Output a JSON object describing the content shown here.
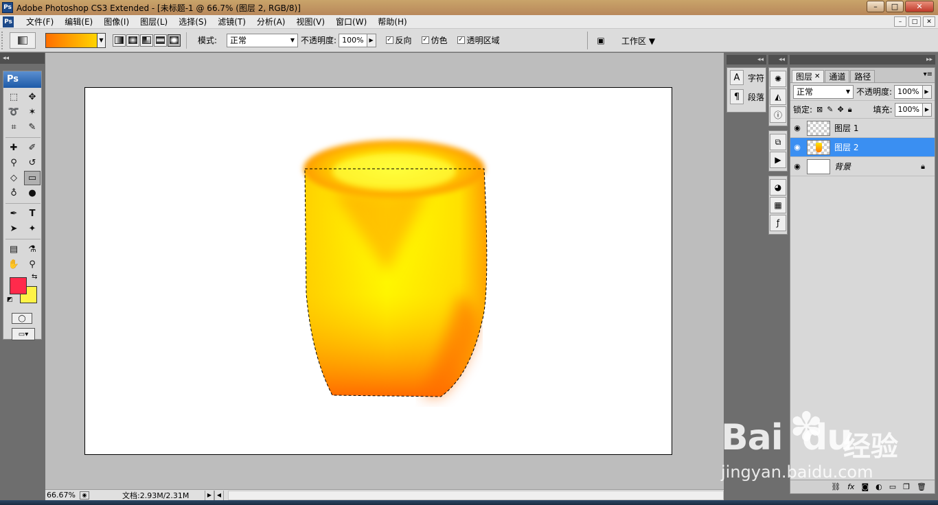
{
  "window": {
    "title": "Adobe Photoshop CS3 Extended - [未标题-1 @ 66.7% (图层 2, RGB/8)]",
    "logo": "Ps",
    "min_label": "–",
    "max_label": "□",
    "close_label": "✕"
  },
  "menu": {
    "items": [
      "文件(F)",
      "编辑(E)",
      "图像(I)",
      "图层(L)",
      "选择(S)",
      "滤镜(T)",
      "分析(A)",
      "视图(V)",
      "窗口(W)",
      "帮助(H)"
    ]
  },
  "options": {
    "mode_label": "模式:",
    "mode_value": "正常",
    "opacity_label": "不透明度:",
    "opacity_value": "100%",
    "reverse_label": "反向",
    "dither_label": "仿色",
    "transparency_label": "透明区域",
    "workspace_label": "工作区 ▼",
    "gradient_colors": [
      "#ff6f00",
      "#ffd400"
    ]
  },
  "tools": {
    "logo": "Ps",
    "foreground_color": "#ff2a4b",
    "background_color": "#fff346"
  },
  "panels": {
    "character_label": "字符",
    "paragraph_label": "段落"
  },
  "layers": {
    "tabs": [
      "图层",
      "通道",
      "路径"
    ],
    "blend_mode": "正常",
    "opacity_label": "不透明度:",
    "opacity_value": "100%",
    "lock_label": "锁定:",
    "fill_label": "填充:",
    "fill_value": "100%",
    "items": [
      {
        "name": "图层 1",
        "selected": false
      },
      {
        "name": "图层 2",
        "selected": true
      },
      {
        "name": "背景",
        "selected": false,
        "locked": true
      }
    ],
    "bottom_icons": [
      "link-icon",
      "fx-icon",
      "mask-icon",
      "adjustment-icon",
      "folder-icon",
      "new-layer-icon",
      "trash-icon"
    ]
  },
  "status": {
    "zoom": "66.67%",
    "doc_size": "文档:2.93M/2.31M"
  },
  "watermark": {
    "brand": "Bai",
    "brand2": "du",
    "cn": "经验",
    "url": "jingyan.baidu.com"
  }
}
